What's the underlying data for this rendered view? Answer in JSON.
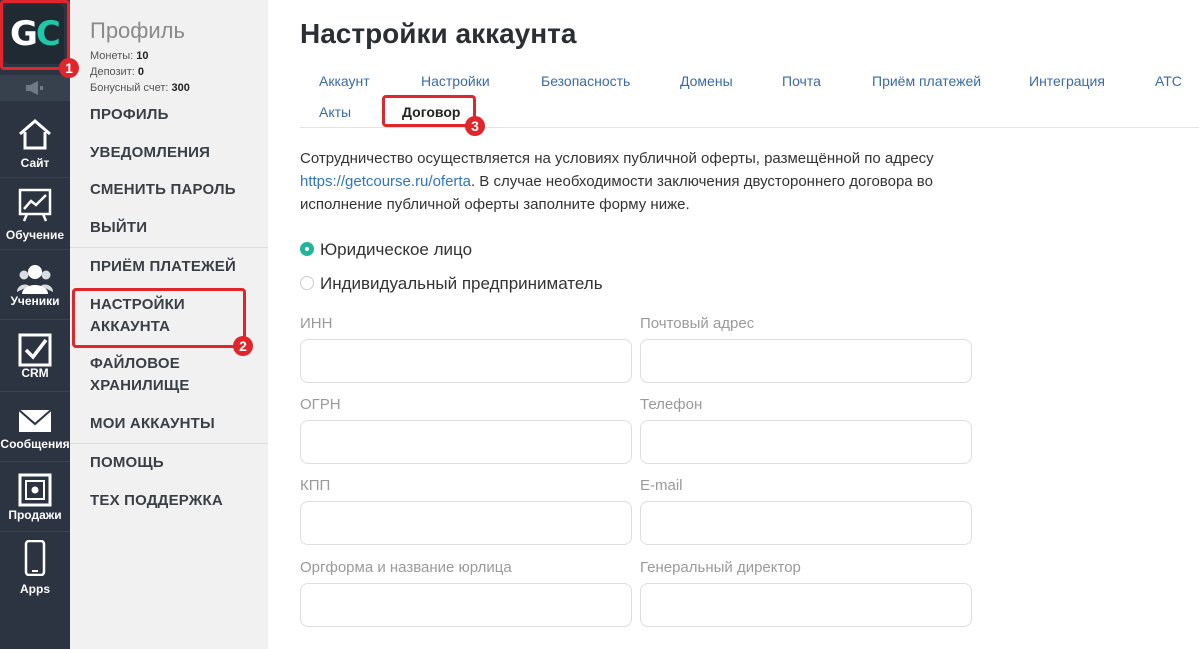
{
  "rail": {
    "logo_text_g": "G",
    "logo_text_c": "C",
    "items": [
      {
        "label": "Сайт",
        "icon": "house-icon"
      },
      {
        "label": "Обучение",
        "icon": "chart-board-icon"
      },
      {
        "label": "Ученики",
        "icon": "users-icon"
      },
      {
        "label": "CRM",
        "icon": "checkbox-icon"
      },
      {
        "label": "Сообщения",
        "icon": "envelope-icon"
      },
      {
        "label": "Продажи",
        "icon": "safe-icon"
      },
      {
        "label": "Apps",
        "icon": "smartphone-icon"
      }
    ]
  },
  "sidebar": {
    "title": "Профиль",
    "stats": [
      {
        "label": "Монеты:",
        "value": "10"
      },
      {
        "label": "Депозит:",
        "value": "0"
      },
      {
        "label": "Бонусный счет:",
        "value": "300"
      }
    ],
    "links": [
      "ПРОФИЛЬ",
      "УВЕДОМЛЕНИЯ",
      "СМЕНИТЬ ПАРОЛЬ",
      "ВЫЙТИ",
      "ПРИЁМ ПЛАТЕЖЕЙ",
      "НАСТРОЙКИ АККАУНТА",
      "ФАЙЛОВОЕ ХРАНИЛИЩЕ",
      "МОИ АККАУНТЫ",
      "ПОМОЩЬ",
      "ТЕХ ПОДДЕРЖКА"
    ]
  },
  "main": {
    "title": "Настройки аккаунта",
    "tabs": [
      "Аккаунт",
      "Настройки",
      "Безопасность",
      "Домены",
      "Почта",
      "Приём платежей",
      "Интеграция",
      "АТС",
      "Акты",
      "Договор"
    ],
    "active_tab": "Договор",
    "intro_before": "Сотрудничество осуществляется на условиях публичной оферты, размещённой по адресу ",
    "intro_link": "https://getcourse.ru/oferta",
    "intro_after": ". В случае необходимости заключения двустороннего договора во исполнение публичной оферты заполните форму ниже.",
    "radio_options": [
      {
        "label": "Юридическое лицо",
        "checked": true
      },
      {
        "label": "Индивидуальный предприниматель",
        "checked": false
      }
    ],
    "fields": [
      {
        "label": "ИНН",
        "value": ""
      },
      {
        "label": "Почтовый адрес",
        "value": ""
      },
      {
        "label": "ОГРН",
        "value": ""
      },
      {
        "label": "Телефон",
        "value": ""
      },
      {
        "label": "КПП",
        "value": ""
      },
      {
        "label": "E-mail",
        "value": ""
      },
      {
        "label": "Оргформа и название юрлица",
        "value": ""
      },
      {
        "label": "Генеральный директор",
        "value": ""
      }
    ]
  },
  "annotations": [
    "1",
    "2",
    "3"
  ],
  "colors": {
    "accent": "#22c7a9",
    "annotation_red": "#e0262b",
    "link": "#2e76c4",
    "rail_bg": "#2b3440"
  }
}
